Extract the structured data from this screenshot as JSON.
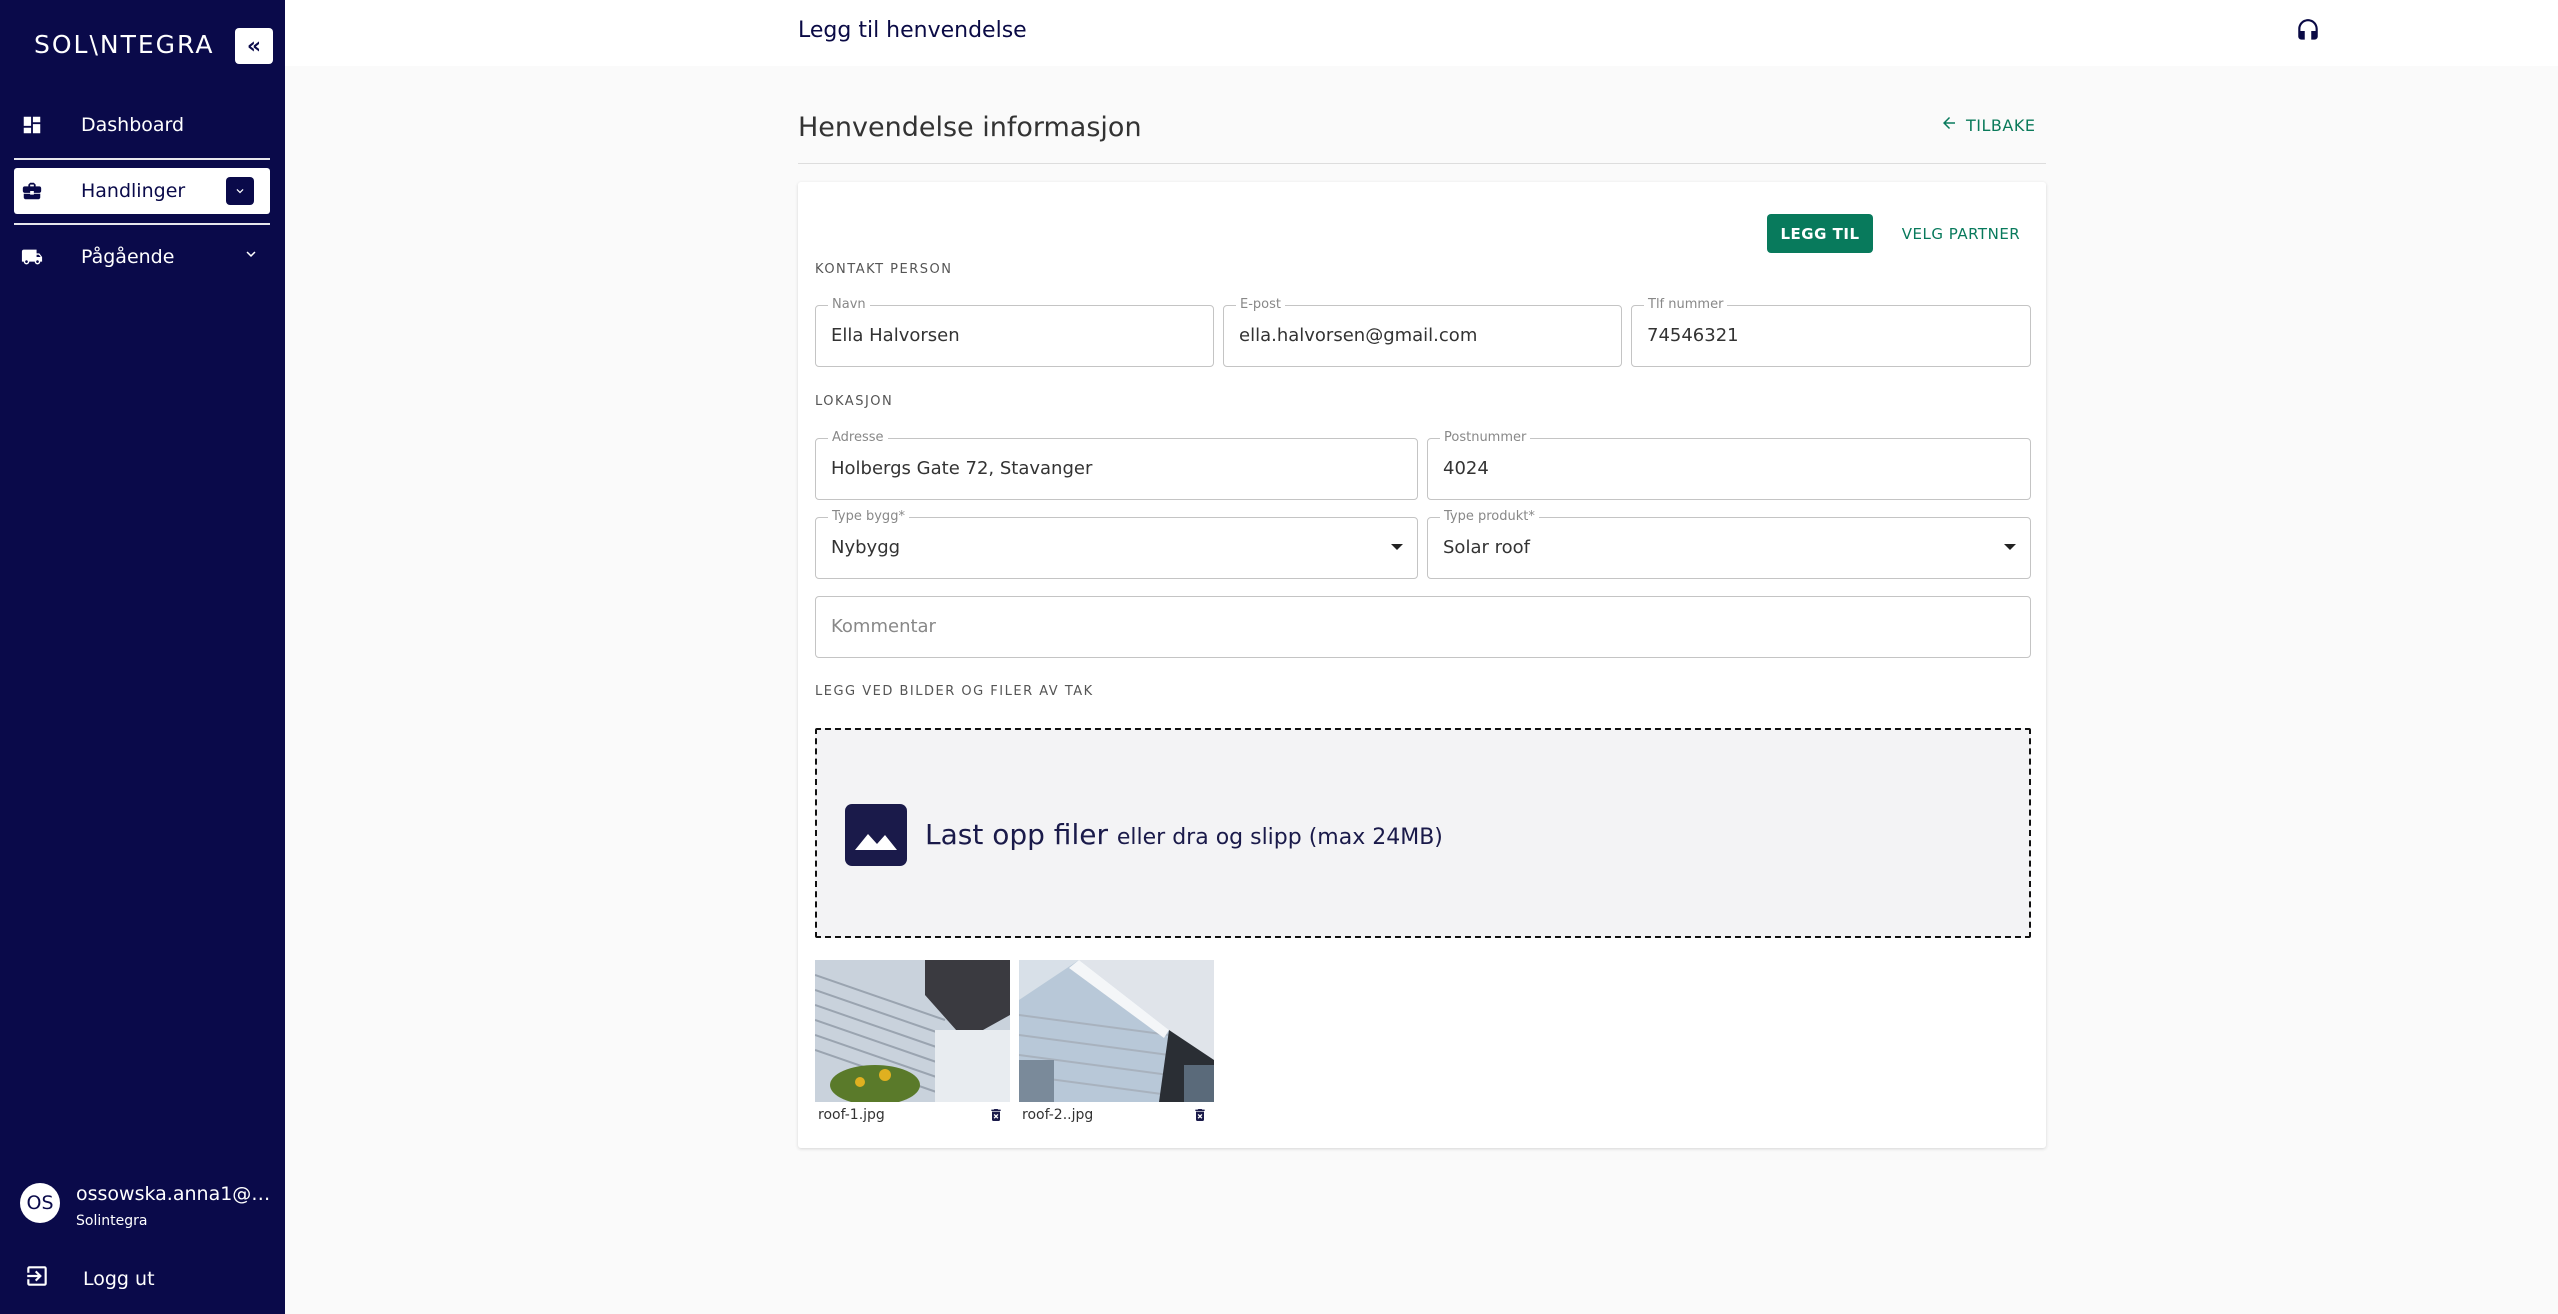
{
  "sidebar": {
    "logo": "SOL\\NTEGRA",
    "collapse_icon": "«",
    "items": [
      {
        "label": "Dashboard",
        "icon": "dashboard-icon"
      },
      {
        "label": "Handlinger",
        "icon": "briefcase-icon"
      },
      {
        "label": "Pågående",
        "icon": "truck-icon"
      }
    ],
    "user": {
      "initials": "OS",
      "email": "ossowska.anna1@gmail.com",
      "org": "Solintegra"
    },
    "logout_label": "Logg ut"
  },
  "header": {
    "title": "Legg til henvendelse",
    "support_icon": "headset-icon"
  },
  "main": {
    "section_title": "Henvendelse informasjon",
    "back_label": "TILBAKE",
    "add_button": "LEGG TIL",
    "partner_button": "VELG PARTNER",
    "contact_label": "KONTAKT PERSON",
    "location_label": "LOKASJON",
    "files_label": "LEGG VED BILDER OG FILER AV TAK",
    "fields": {
      "name": {
        "label": "Navn",
        "value": "Ella Halvorsen"
      },
      "email": {
        "label": "E-post",
        "value": "ella.halvorsen@gmail.com"
      },
      "phone": {
        "label": "Tlf nummer",
        "value": "74546321"
      },
      "address": {
        "label": "Adresse",
        "value": "Holbergs Gate 72, Stavanger"
      },
      "postnr": {
        "label": "Postnummer",
        "value": "4024"
      },
      "building_type": {
        "label": "Type bygg*",
        "value": "Nybygg"
      },
      "product_type": {
        "label": "Type produkt*",
        "value": "Solar roof"
      },
      "comment": {
        "placeholder": "Kommentar"
      }
    },
    "dropzone": {
      "main": "Last opp filer",
      "sub": "eller dra og slipp (max 24MB)"
    },
    "files": [
      {
        "name": "roof-1.jpg"
      },
      {
        "name": "roof-2..jpg"
      }
    ]
  },
  "colors": {
    "sidebar_bg": "#0a0a4a",
    "accent": "#087a5c"
  }
}
